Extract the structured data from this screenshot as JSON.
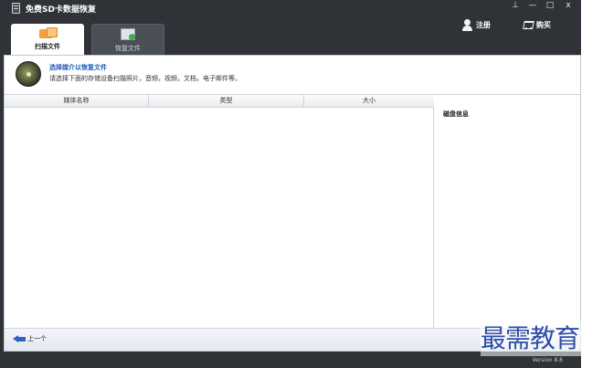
{
  "app": {
    "title": "免费SD卡数据恢复"
  },
  "window_controls": {
    "pin": "⊥",
    "minimize": "—",
    "maximize": "□",
    "close": "x"
  },
  "top_actions": {
    "register": "注册",
    "buy": "购买"
  },
  "tabs": [
    {
      "label": "扫描文件",
      "active": true
    },
    {
      "label": "恢复文件",
      "active": false
    }
  ],
  "info": {
    "title": "选择媒介以恢复文件",
    "description": "请选择下面的存储设备扫描照片，音频，视频，文档，电子邮件等。"
  },
  "table": {
    "columns": [
      "媒体名称",
      "类型",
      "大小"
    ],
    "rows": []
  },
  "side_panel": {
    "title": "磁盘信息"
  },
  "nav": {
    "prev_label": "上一个"
  },
  "status": {
    "version": "Version 8.8"
  },
  "watermark": {
    "text": "最需教育"
  },
  "colors": {
    "chrome": "#2f3237",
    "accent_blue": "#1d5bb8"
  }
}
